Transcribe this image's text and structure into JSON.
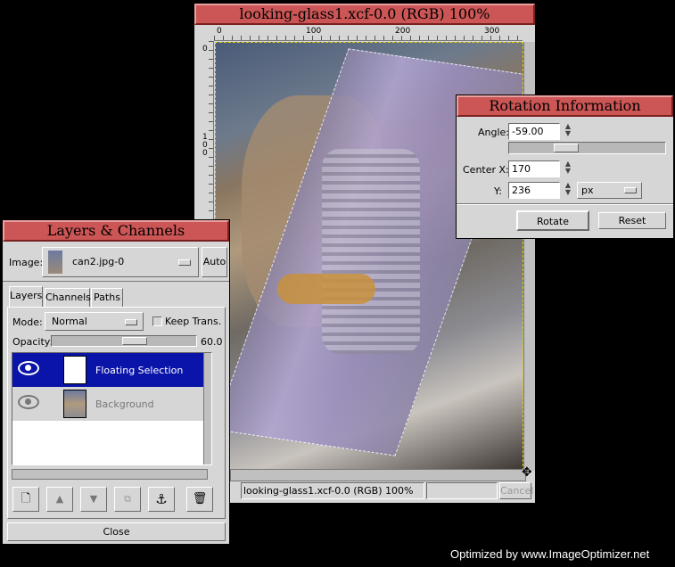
{
  "image_window": {
    "title": "looking-glass1.xcf-0.0 (RGB) 100%",
    "ruler_h": [
      "0",
      "100",
      "200",
      "300"
    ],
    "ruler_v": [
      "0",
      "1\n0\n0"
    ],
    "status": "looking-glass1.xcf-0.0 (RGB) 100%",
    "cancel_label": "Cancel"
  },
  "rotation": {
    "title": "Rotation Information",
    "angle_label": "Angle:",
    "angle_value": "-59.00",
    "centerx_label": "Center X:",
    "centerx_value": "170",
    "y_label": "Y:",
    "y_value": "236",
    "unit": "px",
    "rotate_label": "Rotate",
    "reset_label": "Reset"
  },
  "layers": {
    "title": "Layers & Channels",
    "image_label": "Image:",
    "image_value": "can2.jpg-0",
    "auto_label": "Auto",
    "tabs": [
      "Layers",
      "Channels",
      "Paths"
    ],
    "mode_label": "Mode:",
    "mode_value": "Normal",
    "keep_trans": "Keep Trans.",
    "opacity_label": "Opacity:",
    "opacity_value": "60.0",
    "items": [
      {
        "name": "Floating Selection",
        "selected": true
      },
      {
        "name": "Background",
        "selected": false
      }
    ],
    "close_label": "Close"
  },
  "watermark": "Optimized by www.ImageOptimizer.net"
}
